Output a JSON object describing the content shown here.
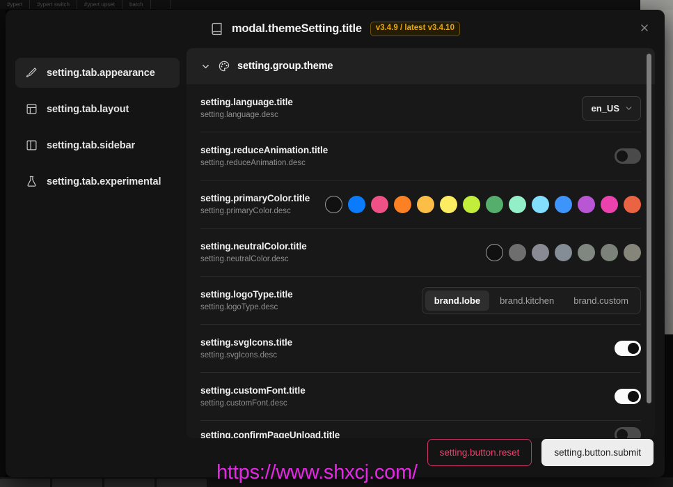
{
  "background": {
    "tabs": [
      "#ypert",
      "#ypert switch",
      "#ypert upset",
      "batch",
      "",
      ""
    ],
    "taskbar_items": 4
  },
  "header": {
    "icon": "book-icon",
    "title": "modal.themeSetting.title",
    "version_badge": "v3.4.9 / latest v3.4.10",
    "close_icon": "close-icon",
    "badge_color": "#e8a90c"
  },
  "sidebar": {
    "items": [
      {
        "label": "setting.tab.appearance",
        "icon": "brush-icon",
        "active": true
      },
      {
        "label": "setting.tab.layout",
        "icon": "layout-icon",
        "active": false
      },
      {
        "label": "setting.tab.sidebar",
        "icon": "panel-icon",
        "active": false
      },
      {
        "label": "setting.tab.experimental",
        "icon": "flask-icon",
        "active": false
      }
    ]
  },
  "group": {
    "chevron_icon": "chevron-down-icon",
    "icon": "palette-icon",
    "title": "setting.group.theme"
  },
  "rows": [
    {
      "title": "setting.language.title",
      "desc": "setting.language.desc",
      "control": "select",
      "value": "en_US",
      "chevron_icon": "chevron-down-icon"
    },
    {
      "title": "setting.reduceAnimation.title",
      "desc": "setting.reduceAnimation.desc",
      "control": "switch",
      "value": "off"
    },
    {
      "title": "setting.primaryColor.title",
      "desc": "setting.primaryColor.desc",
      "control": "swatches",
      "selected_index": 0,
      "colors": [
        "#141414",
        "#0a7cfb",
        "#ef5085",
        "#fb8124",
        "#fdbe48",
        "#fcec62",
        "#c2ed3a",
        "#55ae6c",
        "#93efc8",
        "#83ddfc",
        "#3d94fb",
        "#b956d4",
        "#ec42ae",
        "#ea6343"
      ]
    },
    {
      "title": "setting.neutralColor.title",
      "desc": "setting.neutralColor.desc",
      "control": "swatches",
      "selected_index": 0,
      "colors": [
        "#111111",
        "#6e6e6e",
        "#8a8a94",
        "#848c95",
        "#808780",
        "#7b8279",
        "#85857a"
      ]
    },
    {
      "title": "setting.logoType.title",
      "desc": "setting.logoType.desc",
      "control": "segmented",
      "options": [
        "brand.lobe",
        "brand.kitchen",
        "brand.custom"
      ],
      "selected_index": 0
    },
    {
      "title": "setting.svgIcons.title",
      "desc": "setting.svgIcons.desc",
      "control": "switch",
      "value": "on"
    },
    {
      "title": "setting.customFont.title",
      "desc": "setting.customFont.desc",
      "control": "switch",
      "value": "on"
    },
    {
      "title": "setting.confirmPageUnload.title",
      "desc": "",
      "control": "switch",
      "value": "off",
      "clipped": true
    }
  ],
  "scrollbar": {
    "name": "content-scrollbar"
  },
  "footer": {
    "reset_label": "setting.button.reset",
    "submit_label": "setting.button.submit",
    "reset_color": "#ef3f6e"
  },
  "watermark": {
    "text": "https://www.shxcj.com/",
    "color": "#e528e5"
  }
}
